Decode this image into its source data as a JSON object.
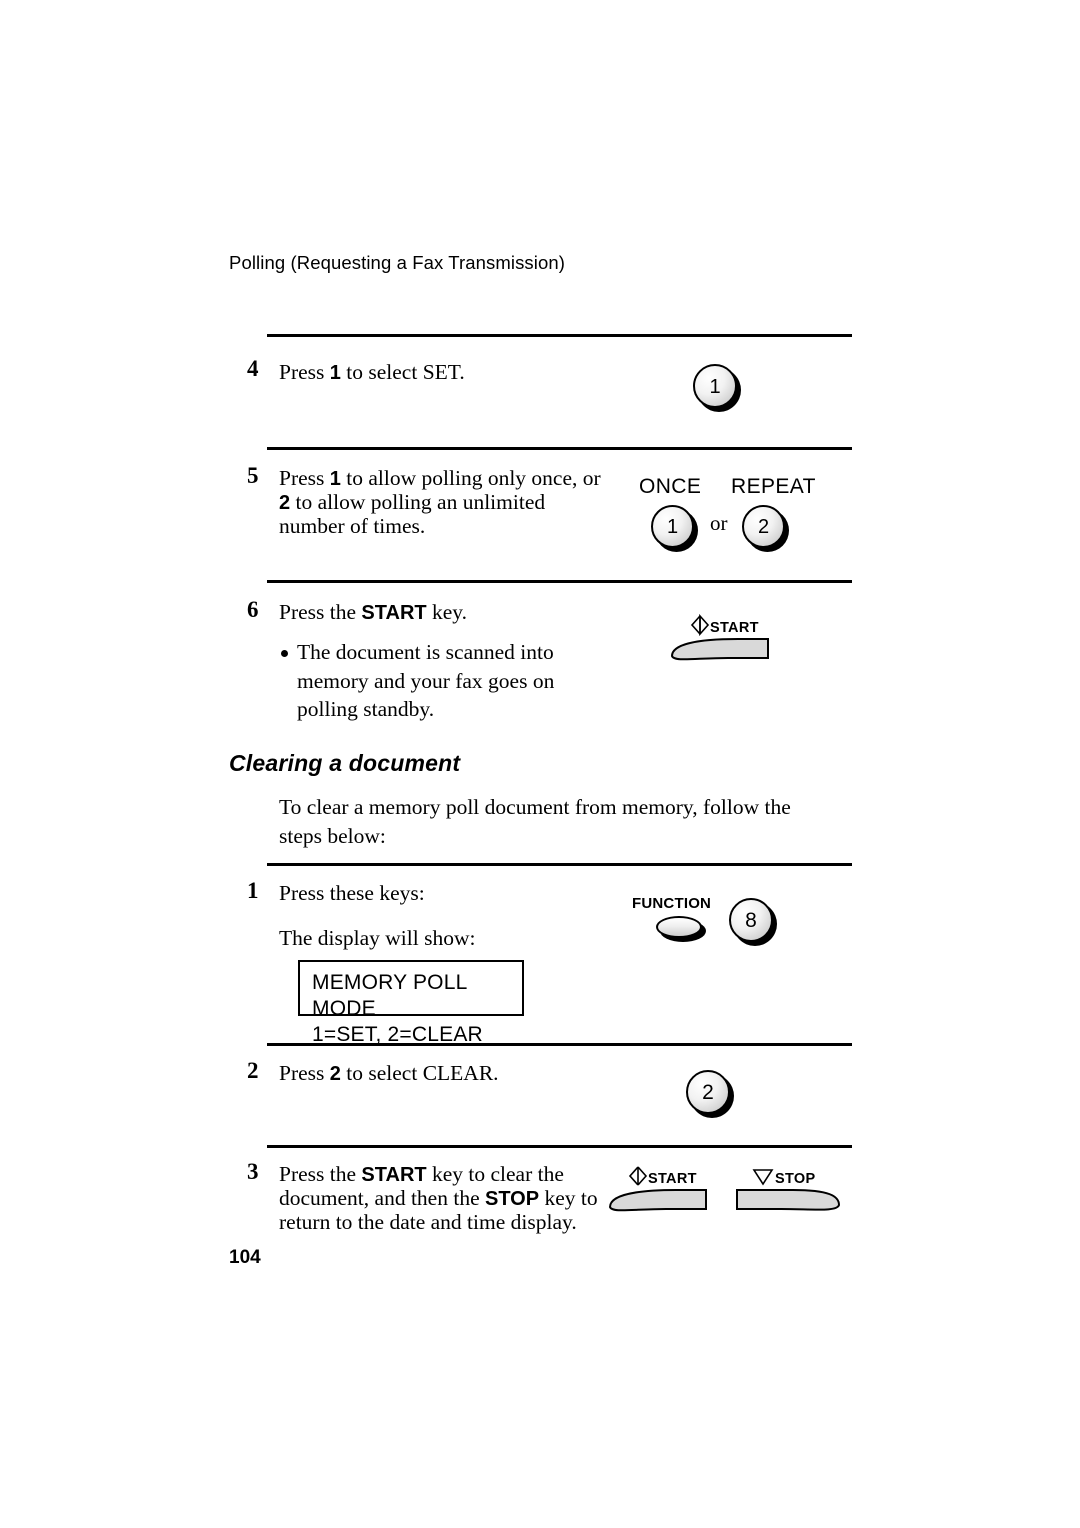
{
  "document": {
    "running_head": "Polling (Requesting a Fax Transmission)",
    "page_number": "104"
  },
  "steps": [
    {
      "number": "4",
      "text_html": "Press <b>1</b> to select SET.",
      "key": "1"
    },
    {
      "number": "5",
      "line1": "Press <b>1</b> to allow polling only once, or",
      "line2": "<b>2</b> to allow polling an unlimited",
      "line3": "number of times.",
      "labels": {
        "once": "ONCE",
        "repeat": "REPEAT",
        "or": "or"
      },
      "key_left": "1",
      "key_right": "2"
    },
    {
      "number": "6",
      "text_html": "Press the <b>START</b> key.",
      "bullet": "The document is scanned into memory and your fax goes on polling standby.",
      "start_label": "START"
    }
  ],
  "section": {
    "heading": "Clearing a document",
    "intro": "To clear a memory poll document from memory, follow the steps below:"
  },
  "clear_steps": [
    {
      "number": "1",
      "line1": "Press these keys:",
      "line2": "The display will show:",
      "function_label": "FUNCTION",
      "key": "8",
      "display_line1": "MEMORY POLL MODE",
      "display_line2": "1=SET, 2=CLEAR"
    },
    {
      "number": "2",
      "text_html": "Press <b>2</b> to select CLEAR.",
      "key": "2"
    },
    {
      "number": "3",
      "line1": "Press the <b>START</b> key to clear the",
      "line2": "document, and then the <b>STOP</b> key to",
      "line3": "return to the date and time display.",
      "start_label": "START",
      "stop_label": "STOP"
    }
  ],
  "colors": {
    "key_fill": "#e0e0e0",
    "line": "#000000",
    "page_bg": "#ffffff"
  }
}
